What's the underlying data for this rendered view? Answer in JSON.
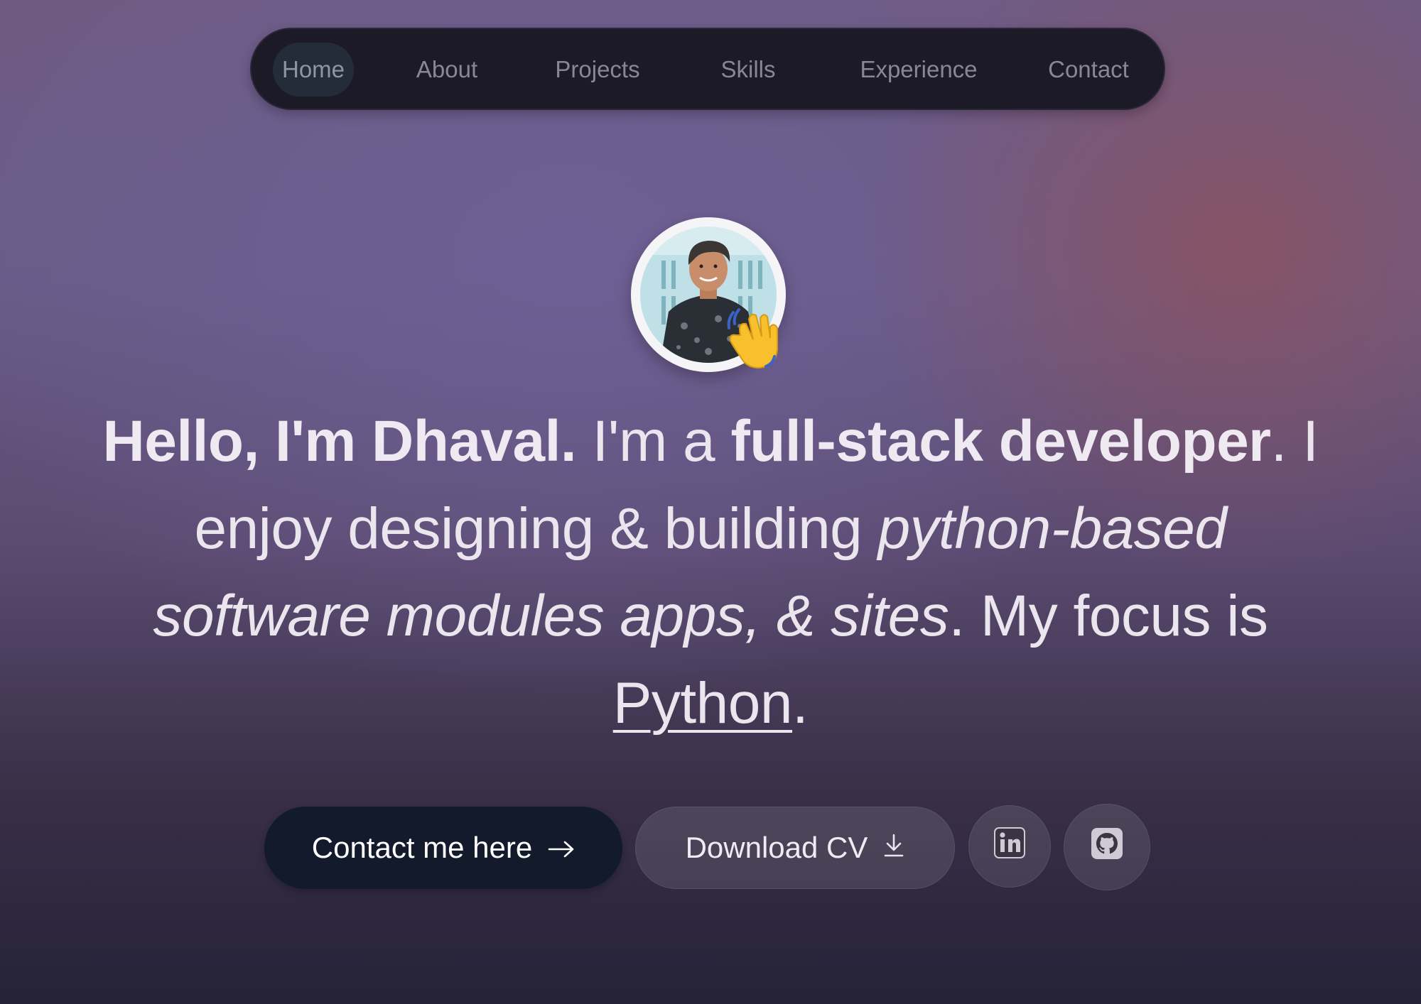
{
  "nav": {
    "items": [
      {
        "label": "Home",
        "active": true
      },
      {
        "label": "About",
        "active": false
      },
      {
        "label": "Projects",
        "active": false
      },
      {
        "label": "Skills",
        "active": false
      },
      {
        "label": "Experience",
        "active": false
      },
      {
        "label": "Contact",
        "active": false
      }
    ]
  },
  "hero": {
    "avatar_alt": "Dhaval profile photo",
    "wave_icon": "waving-hand-icon",
    "headline": {
      "greeting": "Hello, I'm Dhaval.",
      "im_a": "I'm a",
      "role": "full-stack developer",
      "period": ".",
      "enjoy": "I enjoy designing & building",
      "builds": "python-based software modules apps, & sites",
      "focus_prefix": ". My focus is",
      "focus": "Python",
      "end": "."
    }
  },
  "actions": {
    "contact_label": "Contact me here",
    "contact_icon": "arrow-right-icon",
    "cv_label": "Download CV",
    "cv_icon": "download-icon",
    "linkedin_icon": "linkedin-icon",
    "github_icon": "github-icon"
  },
  "colors": {
    "nav_bg": "#1d1a28",
    "nav_active_bg": "#242c3a",
    "primary_button": "#121a2b",
    "text": "#ebe6ee"
  }
}
